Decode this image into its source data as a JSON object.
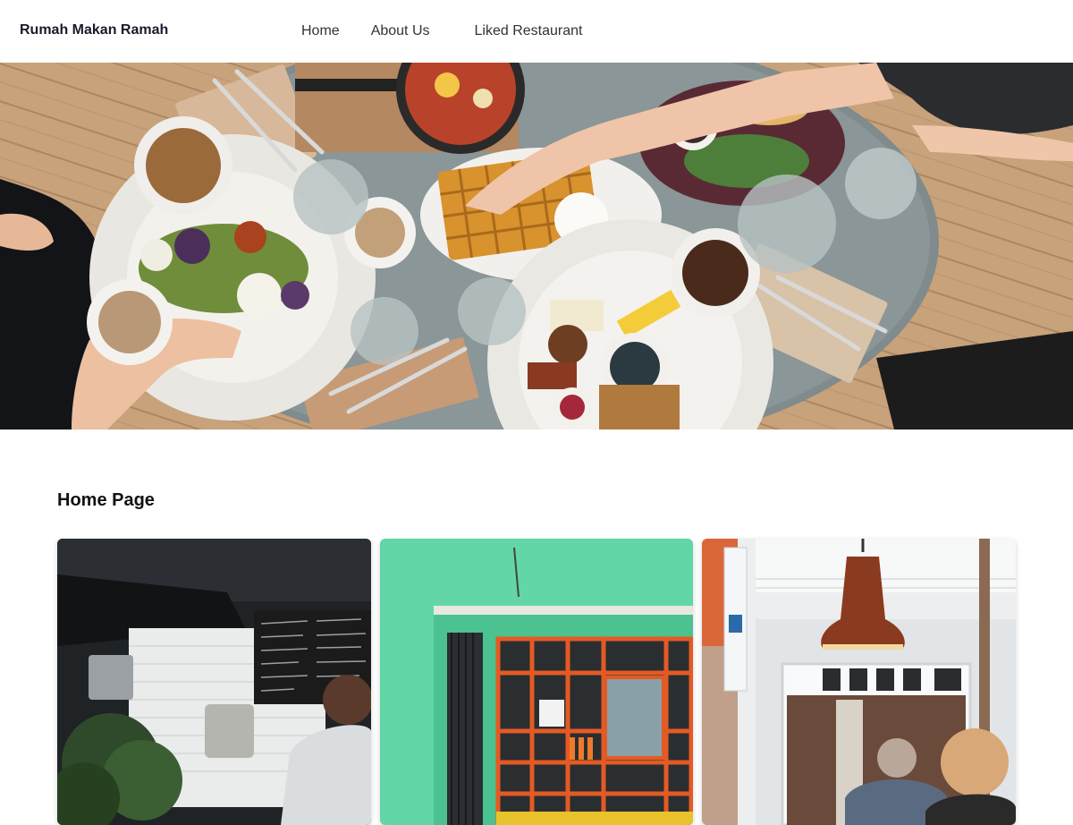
{
  "navbar": {
    "brand": "Rumah Makan Ramah",
    "links": [
      {
        "label": "Home"
      },
      {
        "label": "About Us"
      },
      {
        "label": "Liked Restaurant"
      }
    ]
  },
  "hero": {
    "image_description_icon": "hero-food-table-image"
  },
  "main": {
    "section_title": "Home Page",
    "cards": [
      {
        "image": "restaurant-kitchen-image"
      },
      {
        "image": "green-storefront-image"
      },
      {
        "image": "cafe-lamp-image"
      }
    ]
  },
  "colors": {
    "brand_text": "#1a1a2e",
    "nav_text": "#333333",
    "background": "#ffffff"
  }
}
